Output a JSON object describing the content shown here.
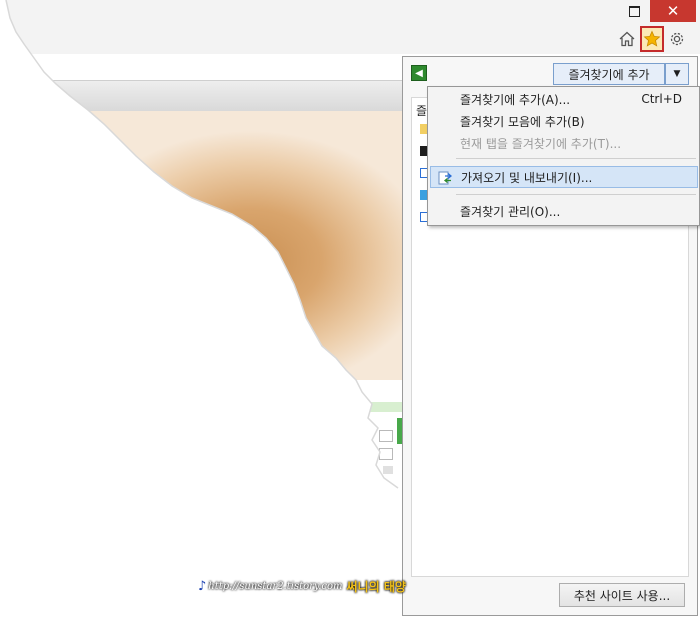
{
  "window_controls": {
    "restore_glyph": "",
    "close_glyph": "✕"
  },
  "toolbar_icons": [
    "home-icon",
    "favorites-star-icon",
    "gear-icon"
  ],
  "favorites_panel": {
    "tab_label_partial": "즐",
    "add_button_label": "즐겨찾기에 추가",
    "suggested_sites_button_label": "추천 사이트 사용..."
  },
  "menu": {
    "items": [
      {
        "label": "즐겨찾기에 추가(A)...",
        "shortcut": "Ctrl+D",
        "enabled": true
      },
      {
        "label": "즐겨찾기 모음에 추가(B)",
        "shortcut": "",
        "enabled": true
      },
      {
        "label": "현재 탭을 즐겨찾기에 추가(T)...",
        "shortcut": "",
        "enabled": false
      },
      {
        "label": "가져오기 및 내보내기(I)...",
        "shortcut": "",
        "enabled": true,
        "highlighted": true
      },
      {
        "label": "즐겨찾기 관리(O)...",
        "shortcut": "",
        "enabled": true
      }
    ]
  },
  "watermark": {
    "url": "http://sunstar2.tistory.com",
    "name": "써니의 태양"
  },
  "colors": {
    "close_button": "#c7372f",
    "highlight": "#d5e5f7",
    "star": "#f5b400",
    "watermark_name": "#f3c21a"
  }
}
